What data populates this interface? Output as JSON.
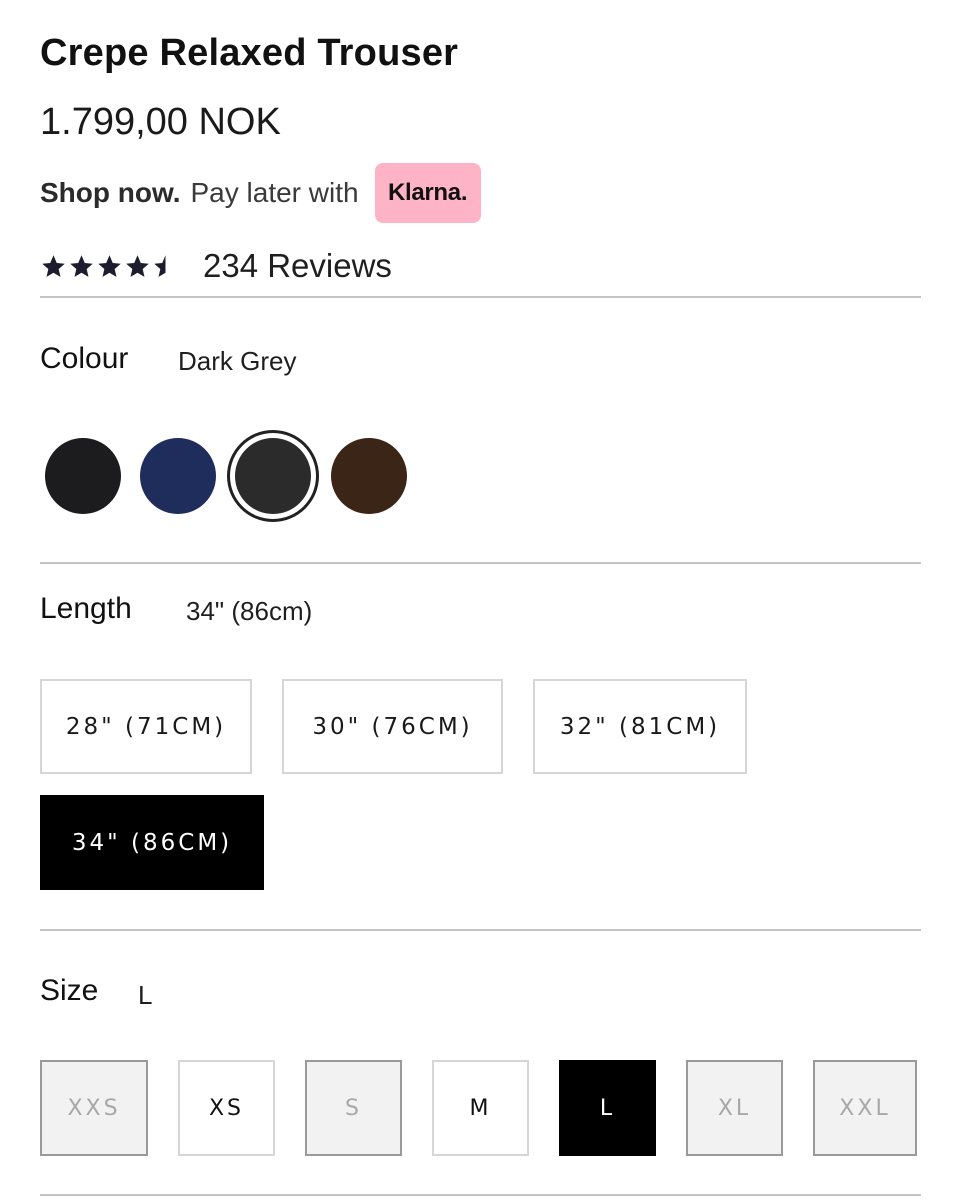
{
  "product": {
    "title": "Crepe Relaxed Trouser",
    "price": "1.799,00 NOK"
  },
  "klarna": {
    "shop_now": "Shop now.",
    "pay_later": "Pay later with",
    "badge": "Klarna.",
    "badge_color": "#ffb3c7"
  },
  "rating": {
    "stars": 4.5,
    "max_stars": 5,
    "star_icon": "star-icon",
    "reviews_label": "234 Reviews"
  },
  "colour": {
    "label": "Colour",
    "selected": "Dark Grey",
    "swatches": [
      {
        "color": "#1c1c1e",
        "selected": false
      },
      {
        "color": "#1f2d5c",
        "selected": false
      },
      {
        "color": "#2b2b2b",
        "selected": true
      },
      {
        "color": "#3b2516",
        "selected": false
      }
    ]
  },
  "length": {
    "label": "Length",
    "selected": "34\" (86cm)",
    "options": [
      {
        "label": "28\" (71CM)",
        "selected": false
      },
      {
        "label": "30\" (76CM)",
        "selected": false
      },
      {
        "label": "32\" (81CM)",
        "selected": false
      },
      {
        "label": "34\" (86CM)",
        "selected": true
      }
    ]
  },
  "size": {
    "label": "Size",
    "selected": "L",
    "options": [
      {
        "label": "XXS",
        "available": false,
        "selected": false
      },
      {
        "label": "XS",
        "available": true,
        "selected": false
      },
      {
        "label": "S",
        "available": false,
        "selected": false
      },
      {
        "label": "M",
        "available": true,
        "selected": false
      },
      {
        "label": "L",
        "available": true,
        "selected": true
      },
      {
        "label": "XL",
        "available": false,
        "selected": false
      },
      {
        "label": "XXL",
        "available": false,
        "selected": false
      }
    ]
  }
}
